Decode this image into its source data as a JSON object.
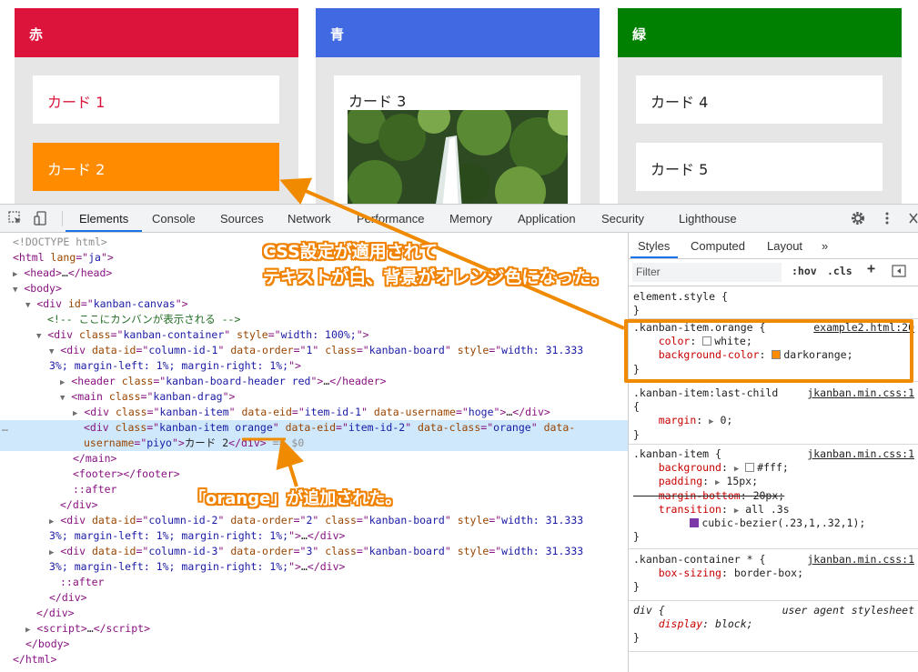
{
  "kanban": {
    "boards": [
      {
        "header": "赤",
        "color": "#dc143c",
        "cards": [
          "カード 1",
          "カード 2"
        ]
      },
      {
        "header": "青",
        "color": "#4169e1",
        "cards": [
          "カード 3"
        ]
      },
      {
        "header": "緑",
        "color": "#008000",
        "cards": [
          "カード 4",
          "カード 5"
        ]
      }
    ]
  },
  "devtools": {
    "tabs": [
      "Elements",
      "Console",
      "Sources",
      "Network",
      "Performance",
      "Memory",
      "Application",
      "Security",
      "Lighthouse"
    ],
    "active_tab": "Elements",
    "dom": {
      "doctype": "<!DOCTYPE html>",
      "html_lang": "ja",
      "canvas_id": "kanban-canvas",
      "comment": "<!-- ここにカンバンが表示される -->",
      "container_class": "kanban-container",
      "container_style": "width: 100%;",
      "col1": {
        "id": "column-id-1",
        "order": "1",
        "style": "width: 31.3333%; margin-left: 1%; margin-right: 1%;"
      },
      "col2": {
        "id": "column-id-2",
        "order": "2"
      },
      "col3": {
        "id": "column-id-3",
        "order": "3"
      },
      "board_class": "kanban-board",
      "header_class": "kanban-board-header red",
      "main_class": "kanban-drag",
      "item1": {
        "eid": "item-id-1",
        "username": "hoge"
      },
      "item2": {
        "class_base": "kanban-item",
        "class_added": "orange",
        "eid": "item-id-2",
        "data_class": "orange",
        "username": "piyo",
        "text": "カード 2"
      },
      "selected_marker": "== $0"
    },
    "styles": {
      "tabs": [
        "Styles",
        "Computed",
        "Layout"
      ],
      "filter_placeholder": "Filter",
      "buttons": [
        ":hov",
        ".cls",
        "+"
      ],
      "rules": [
        {
          "selector": "element.style",
          "source": ""
        },
        {
          "selector": ".kanban-item.orange",
          "source": "example2.html:20",
          "props": [
            [
              "color",
              "white"
            ],
            [
              "background-color",
              "darkorange"
            ]
          ]
        },
        {
          "selector": ".kanban-item:last-child",
          "source": "jkanban.min.css:1",
          "props": [
            [
              "margin",
              "0"
            ]
          ]
        },
        {
          "selector": ".kanban-item",
          "source": "jkanban.min.css:1",
          "props": [
            [
              "background",
              "#fff"
            ],
            [
              "padding",
              "15px"
            ],
            [
              "margin-bottom",
              "20px"
            ],
            [
              "transition",
              "all .3s"
            ]
          ],
          "extra": "cubic-bezier(.23,1,.32,1);"
        },
        {
          "selector": ".kanban-container *",
          "source": "jkanban.min.css:1",
          "props": [
            [
              "box-sizing",
              "border-box"
            ]
          ]
        },
        {
          "selector": "div",
          "source": "user agent stylesheet",
          "props": [
            [
              "display",
              "block"
            ]
          ]
        }
      ]
    }
  },
  "annotations": {
    "callout1_line1": "CSS設定が適用されて",
    "callout1_line2": "テキストが白、背景がオレンジ色になった。",
    "callout2": "「orange」が追加された。",
    "accent": "#f08a00"
  }
}
